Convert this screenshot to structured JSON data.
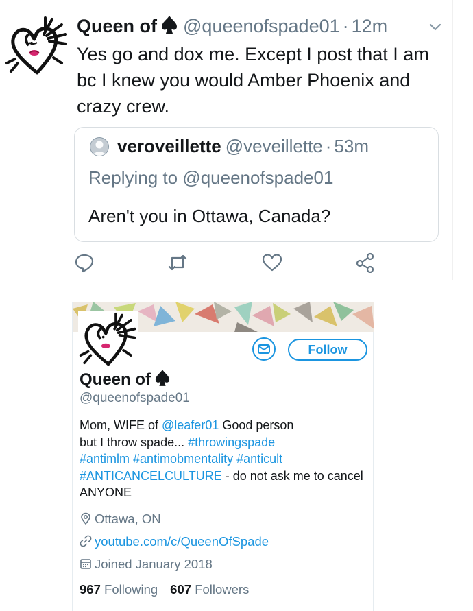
{
  "tweet": {
    "name": "Queen of",
    "handle": "@queenofspade01",
    "time": "12m",
    "text": "Yes go and dox me. Except I post that I am bc I knew you would Amber Phoenix and crazy crew.",
    "quoted": {
      "name": "veroveillette",
      "handle": "@veveillette",
      "time": "53m",
      "replying_to": "Replying to @queenofspade01",
      "text": "Aren't you in Ottawa, Canada?"
    },
    "actions": [
      "reply-icon",
      "retweet-icon",
      "like-icon",
      "share-icon"
    ]
  },
  "profile": {
    "name": "Queen of",
    "handle": "@queenofspade01",
    "follow_label": "Follow",
    "bio": {
      "line1_pre": "Mom, WIFE of ",
      "line1_mention": "@leafer01",
      "line1_post": " Good person",
      "line2_pre": "but I throw spade... ",
      "line2_tag": "#throwingspade",
      "line3_tags": "#antimlm #antimobmentality #anticult",
      "line4_tag": "#ANTICANCELCULTURE",
      "line4_post": " - do not ask me to cancel",
      "line5": "ANYONE"
    },
    "location": "Ottawa, ON",
    "url": "youtube.com/c/QueenOfSpade",
    "joined": "Joined January 2018",
    "following_count": "967",
    "following_label": "Following",
    "followers_count": "607",
    "followers_label": "Followers"
  },
  "colors": {
    "accent": "#1b95e0",
    "secondary_text": "#657786",
    "primary_text": "#14171a",
    "border": "#e6ecf0"
  }
}
